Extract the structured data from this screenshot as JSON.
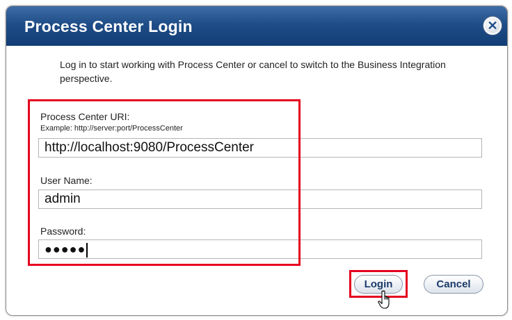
{
  "dialog": {
    "title": "Process Center Login",
    "intro_text": "Log in to start working with Process Center or cancel to switch to the Business Integration perspective."
  },
  "fields": {
    "uri_label": "Process Center URI:",
    "uri_example": "Example: http://server:port/ProcessCenter",
    "uri_value": "http://localhost:9080/ProcessCenter",
    "username_label": "User Name:",
    "username_value": "admin",
    "password_label": "Password:",
    "password_masked": "●●●●●"
  },
  "buttons": {
    "login": "Login",
    "cancel": "Cancel"
  },
  "icons": {
    "close": "close-icon",
    "cursor": "hand-pointer-icon"
  },
  "colors": {
    "titlebar": "#1f4d87",
    "highlight": "#e5001f"
  }
}
